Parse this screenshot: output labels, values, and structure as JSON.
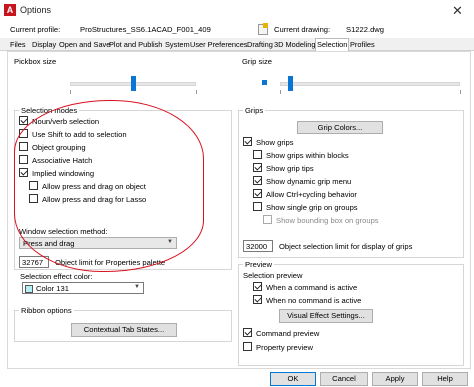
{
  "window": {
    "title": "Options",
    "icon_letter": "A"
  },
  "profile": {
    "current_profile_label": "Current profile:",
    "current_profile_value": "ProStructures_SS6.1ACAD_F001_409",
    "current_drawing_label": "Current drawing:",
    "current_drawing_value": "S1222.dwg"
  },
  "tabs": [
    "Files",
    "Display",
    "Open and Save",
    "Plot and Publish",
    "System",
    "User Preferences",
    "Drafting",
    "3D Modeling",
    "Selection",
    "Profiles"
  ],
  "active_tab": "Selection",
  "left": {
    "pickbox_label": "Pickbox size",
    "pickbox_level": 0.5,
    "selection_modes": {
      "title": "Selection modes",
      "items": [
        {
          "label": "Noun/verb selection",
          "checked": true
        },
        {
          "label": "Use Shift to add to selection",
          "checked": false
        },
        {
          "label": "Object grouping",
          "checked": false
        },
        {
          "label": "Associative Hatch",
          "checked": false
        },
        {
          "label": "Implied windowing",
          "checked": true
        },
        {
          "label": "Allow press and drag on object",
          "checked": false
        },
        {
          "label": "Allow press and drag for Lasso",
          "checked": false
        }
      ],
      "window_method_label": "Window selection method:",
      "window_method_value": "Press and drag",
      "object_limit_value": "32767",
      "object_limit_label": "Object limit for Properties palette"
    },
    "effect_color_label": "Selection effect color:",
    "effect_color_value": "Color 131",
    "effect_color_swatch": "#b5f0f4",
    "ribbon": {
      "title": "Ribbon options",
      "button": "Contextual Tab States..."
    }
  },
  "right": {
    "grip_size_label": "Grip size",
    "grip_level": 0.06,
    "grips": {
      "title": "Grips",
      "grip_colors_button": "Grip Colors...",
      "items": [
        {
          "label": "Show grips",
          "checked": true
        },
        {
          "label": "Show grips within blocks",
          "checked": false
        },
        {
          "label": "Show grip tips",
          "checked": true
        },
        {
          "label": "Show dynamic grip menu",
          "checked": true
        },
        {
          "label": "Allow Ctrl+cycling behavior",
          "checked": true
        },
        {
          "label": "Show single grip on groups",
          "checked": false
        },
        {
          "label": "Show bounding box on groups",
          "checked": false
        }
      ],
      "limit_value": "32000",
      "limit_label": "Object selection limit for display of grips"
    },
    "preview": {
      "title": "Preview",
      "selection_preview_label": "Selection preview",
      "items": [
        {
          "label": "When a command is active",
          "checked": true
        },
        {
          "label": "When no command is active",
          "checked": true
        }
      ],
      "visual_effect_button": "Visual Effect Settings...",
      "command_preview": {
        "label": "Command preview",
        "checked": true
      },
      "property_preview": {
        "label": "Property preview",
        "checked": false
      }
    }
  },
  "footer": {
    "ok": "OK",
    "cancel": "Cancel",
    "apply": "Apply",
    "help": "Help"
  },
  "annotation_color": "#d8121f"
}
